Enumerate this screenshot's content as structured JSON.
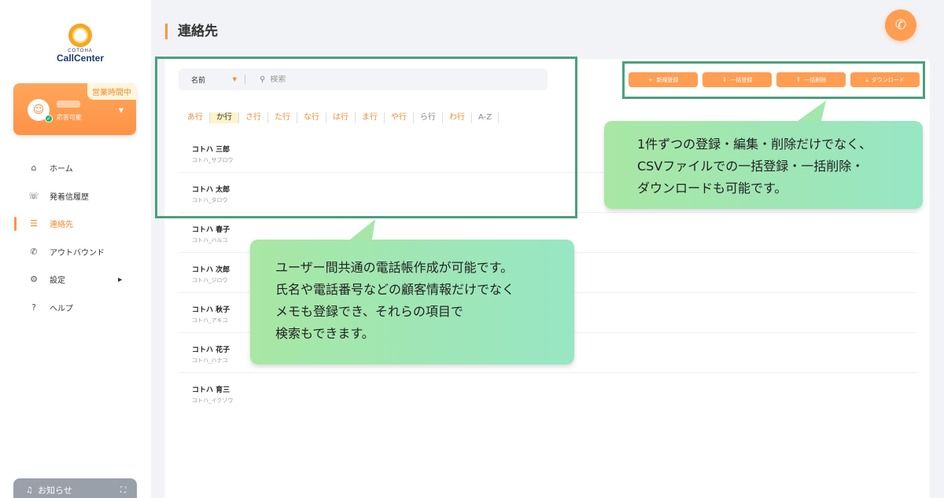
{
  "sidebar": {
    "logo": {
      "small": "COTOHA",
      "main": "CallCenter"
    },
    "status": {
      "badge": "営業時間中",
      "sub": "応答可能"
    },
    "nav": [
      {
        "label": "ホーム",
        "icon": "home-icon",
        "glyph": "⌂"
      },
      {
        "label": "発着信履歴",
        "icon": "phone-history-icon",
        "glyph": "☏"
      },
      {
        "label": "連絡先",
        "icon": "list-icon",
        "glyph": "☰"
      },
      {
        "label": "アウトバウンド",
        "icon": "outbound-icon",
        "glyph": "✆"
      },
      {
        "label": "設定",
        "icon": "gear-icon",
        "glyph": "⚙"
      },
      {
        "label": "ヘルプ",
        "icon": "help-icon",
        "glyph": "?"
      }
    ],
    "notice": "お知らせ"
  },
  "header": {
    "title": "連絡先"
  },
  "search": {
    "field": "名前",
    "placeholder": "検索"
  },
  "kana_tabs": [
    "あ行",
    "か行",
    "さ行",
    "た行",
    "な行",
    "は行",
    "ま行",
    "や行",
    "ら行",
    "わ行",
    "A-Z"
  ],
  "actions": {
    "new": "新規登録",
    "bulk_register": "一括登録",
    "bulk_delete": "一括削除",
    "download": "ダウンロード"
  },
  "contacts": [
    {
      "name": "コトハ 三郎",
      "kana": "コトハ_サブロウ"
    },
    {
      "name": "コトハ 太郎",
      "kana": "コトハ_タロウ"
    },
    {
      "name": "コトハ 春子",
      "kana": "コトハ_ハルコ"
    },
    {
      "name": "コトハ 次郎",
      "kana": "コトハ_ジロウ"
    },
    {
      "name": "コトハ 秋子",
      "kana": "コトハ_アキコ"
    },
    {
      "name": "コトハ 花子",
      "kana": "コトハ_ハナコ"
    },
    {
      "name": "コトハ 育三",
      "kana": "コトハ_イクゾウ"
    }
  ],
  "callouts": {
    "right": [
      "1件ずつの登録・編集・削除だけでなく、",
      "CSVファイルでの一括登録・一括削除・",
      "ダウンロードも可能です。"
    ],
    "left": [
      "ユーザー間共通の電話帳作成が可能です。",
      "氏名や電話番号などの顧客情報だけでなく",
      "メモも登録でき、それらの項目で",
      "検索もできます。"
    ]
  },
  "colors": {
    "accent": "#ff9d52",
    "highlight_border": "#4aa07a",
    "callout_green": "#a8e7a4"
  }
}
